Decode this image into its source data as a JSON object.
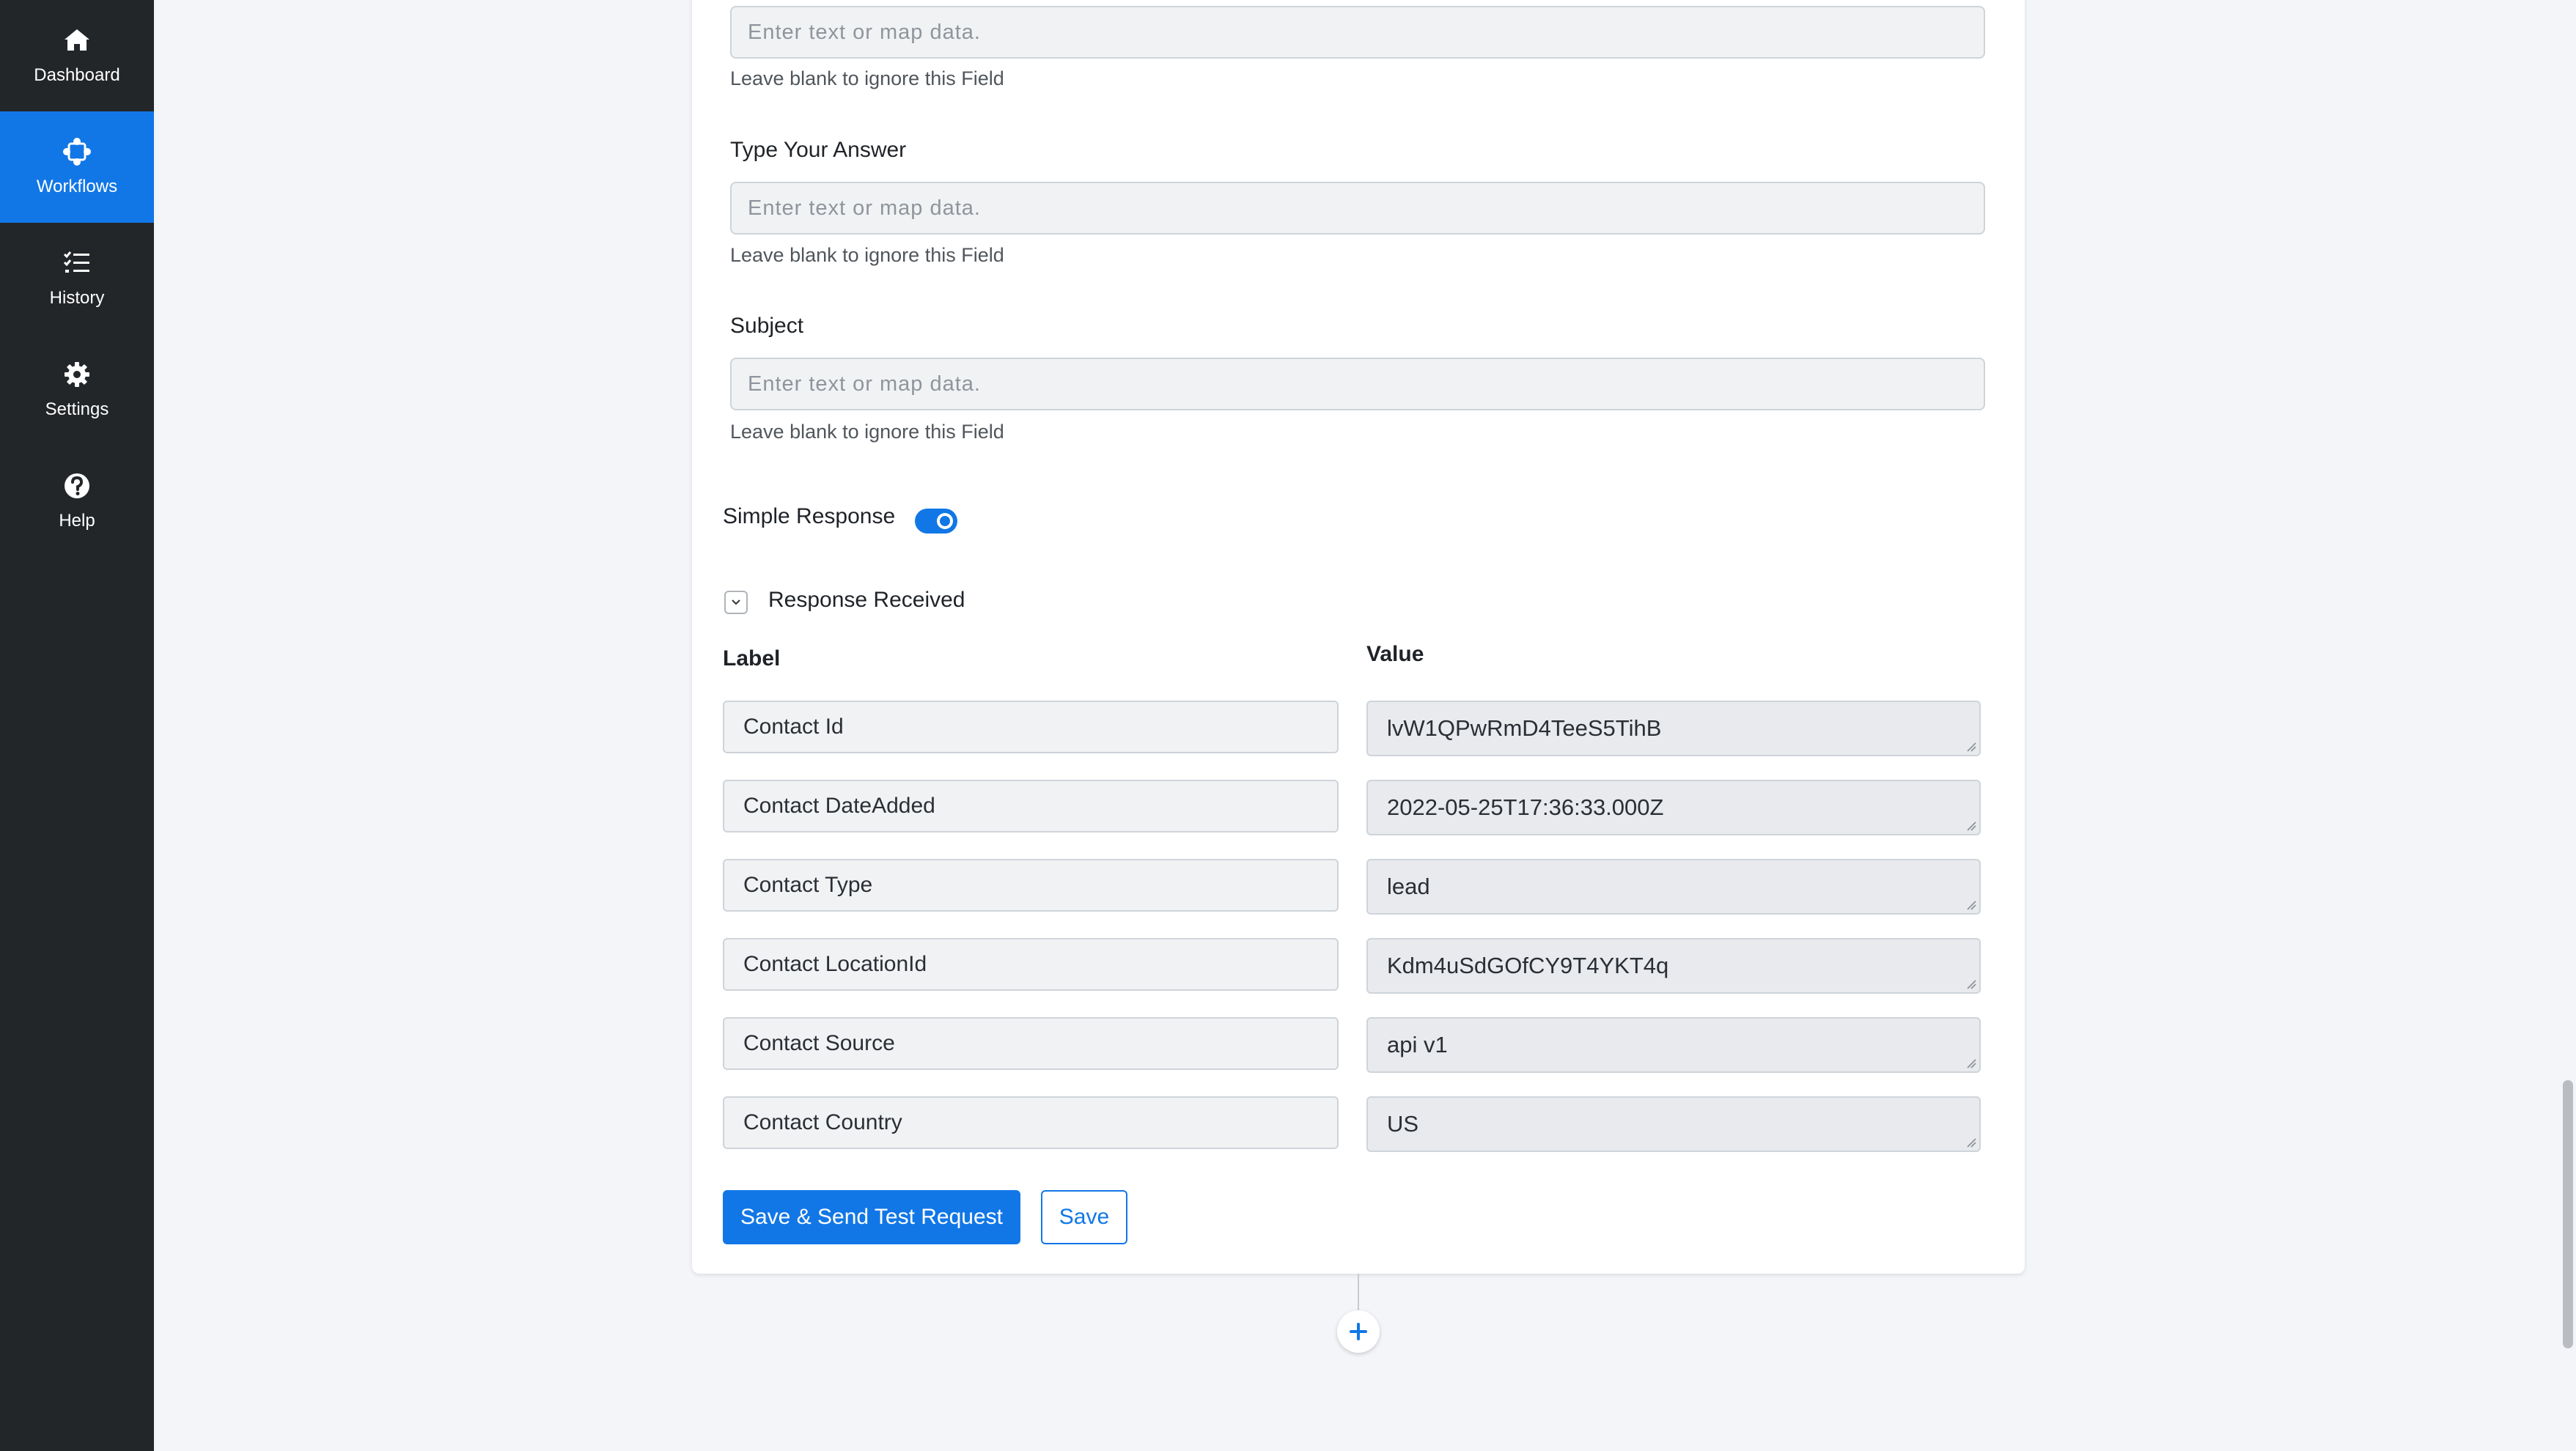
{
  "sidebar": {
    "items": [
      {
        "label": "Dashboard",
        "icon": "home-icon",
        "active": false
      },
      {
        "label": "Workflows",
        "icon": "workflow-icon",
        "active": true
      },
      {
        "label": "History",
        "icon": "history-list-icon",
        "active": false
      },
      {
        "label": "Settings",
        "icon": "gear-icon",
        "active": false
      },
      {
        "label": "Help",
        "icon": "help-icon",
        "active": false
      }
    ]
  },
  "form": {
    "fields": [
      {
        "label": "",
        "placeholder": "Enter text or map data.",
        "hint": "Leave blank to ignore this Field"
      },
      {
        "label": "Type Your Answer",
        "placeholder": "Enter text or map data.",
        "hint": "Leave blank to ignore this Field"
      },
      {
        "label": "Subject",
        "placeholder": "Enter text or map data.",
        "hint": "Leave blank to ignore this Field"
      }
    ],
    "simple_response": {
      "label": "Simple Response",
      "enabled": true
    },
    "response_received": {
      "title": "Response Received",
      "expanded": true
    },
    "columns": {
      "label": "Label",
      "value": "Value"
    },
    "rows": [
      {
        "label": "Contact Id",
        "value": "lvW1QPwRmD4TeeS5TihB"
      },
      {
        "label": "Contact DateAdded",
        "value": "2022-05-25T17:36:33.000Z"
      },
      {
        "label": "Contact Type",
        "value": "lead"
      },
      {
        "label": "Contact LocationId",
        "value": "Kdm4uSdGOfCY9T4YKT4q"
      },
      {
        "label": "Contact Source",
        "value": "api v1"
      },
      {
        "label": "Contact Country",
        "value": "US"
      }
    ],
    "buttons": {
      "save_and_test": "Save & Send Test Request",
      "save": "Save"
    }
  },
  "colors": {
    "accent": "#1277e6",
    "sidebar_bg": "#232629",
    "page_bg": "#f3f5f8"
  }
}
